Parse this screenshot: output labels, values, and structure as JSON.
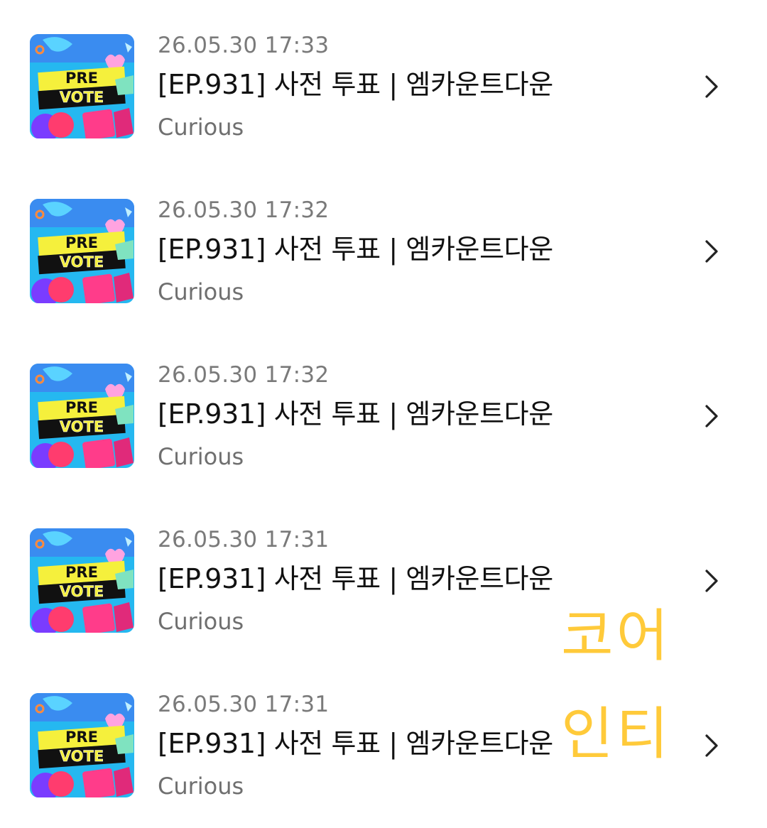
{
  "items": [
    {
      "time": "26.05.30 17:33",
      "title": "[EP.931] 사전 투표 | 엠카운트다운",
      "artist": "Curious",
      "thumb": {
        "line1": "PRE",
        "line2": "VOTE"
      }
    },
    {
      "time": "26.05.30 17:32",
      "title": "[EP.931] 사전 투표 | 엠카운트다운",
      "artist": "Curious",
      "thumb": {
        "line1": "PRE",
        "line2": "VOTE"
      }
    },
    {
      "time": "26.05.30 17:32",
      "title": "[EP.931] 사전 투표 | 엠카운트다운",
      "artist": "Curious",
      "thumb": {
        "line1": "PRE",
        "line2": "VOTE"
      }
    },
    {
      "time": "26.05.30 17:31",
      "title": "[EP.931] 사전 투표 | 엠카운트다운",
      "artist": "Curious",
      "thumb": {
        "line1": "PRE",
        "line2": "VOTE"
      }
    },
    {
      "time": "26.05.30 17:31",
      "title": "[EP.931] 사전 투표 | 엠카운트다운",
      "artist": "Curious",
      "thumb": {
        "line1": "PRE",
        "line2": "VOTE"
      }
    }
  ],
  "watermark": {
    "line1": "코어",
    "line2": "인티"
  },
  "colors": {
    "time_text": "#7a7a7a",
    "title_text": "#111111",
    "artist_text": "#6f6f6f",
    "chevron": "#222222",
    "watermark": "#ffc830",
    "thumb_background": "#25b8f0",
    "thumb_banner": "#f5f03c",
    "thumb_banner_dark": "#111111"
  },
  "icons": {
    "row_arrow": "chevron-right-icon",
    "thumbnail": "pre-vote-thumbnail"
  }
}
